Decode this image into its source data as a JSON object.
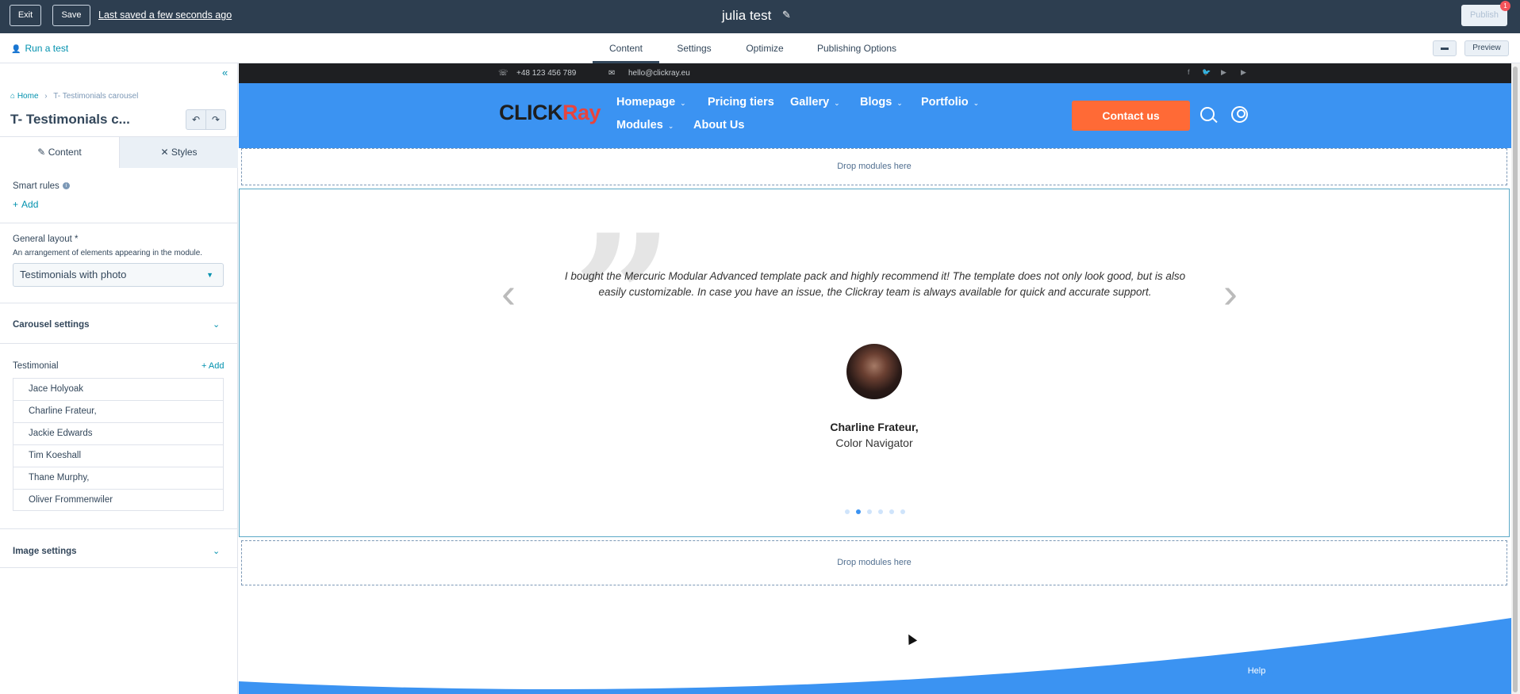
{
  "topbar": {
    "exit_label": "Exit",
    "save_label": "Save",
    "saved_status": "Last saved a few seconds ago",
    "page_title": "julia test",
    "publish_label": "Publish",
    "publish_badge": "1"
  },
  "subbar": {
    "run_test": "Run a test",
    "tabs": [
      "Content",
      "Settings",
      "Optimize",
      "Publishing Options"
    ],
    "active_tab": "Content",
    "preview_label": "Preview"
  },
  "sidebar": {
    "breadcrumb": {
      "home": "Home",
      "separator": "›",
      "current": "T- Testimonials carousel"
    },
    "module_title": "T- Testimonials c...",
    "tabs": {
      "content": "Content",
      "styles": "Styles"
    },
    "smart_rules": {
      "label": "Smart rules",
      "add": "Add"
    },
    "general_layout": {
      "label": "General layout *",
      "description": "An arrangement of elements appearing in the module.",
      "selected": "Testimonials with photo"
    },
    "carousel_settings": "Carousel settings",
    "testimonial": {
      "label": "Testimonial",
      "add": "+ Add",
      "items": [
        "Jace Holyoak",
        "Charline Frateur,",
        "Jackie Edwards",
        "Tim Koeshall",
        "Thane Murphy,",
        "Oliver Frommenwiler"
      ]
    },
    "image_settings": "Image settings"
  },
  "site": {
    "infobar": {
      "phone": "+48 123 456 789",
      "email": "hello@clickray.eu"
    },
    "logo": {
      "part1": "CLICK",
      "part2": "Ray"
    },
    "menu": [
      "Homepage",
      "Pricing tiers",
      "Gallery",
      "Blogs",
      "Portfolio",
      "Modules",
      "About Us"
    ],
    "contact_label": "Contact us",
    "drop_label": "Drop modules here",
    "testimonial": {
      "quote": "I bought the Mercuric Modular Advanced template pack and highly recommend it! The template does not only look good, but is also easily customizable. In case you have an issue, the Clickray team is always available for quick and accurate support.",
      "name": "Charline Frateur,",
      "role": "Color Navigator",
      "slide_count": 6,
      "active_slide": 2
    },
    "help_label": "Help"
  },
  "colors": {
    "topbar": "#2d3e50",
    "link": "#0091ae",
    "nav_blue": "#3b93f2",
    "contact_orange": "#ff6a36"
  }
}
